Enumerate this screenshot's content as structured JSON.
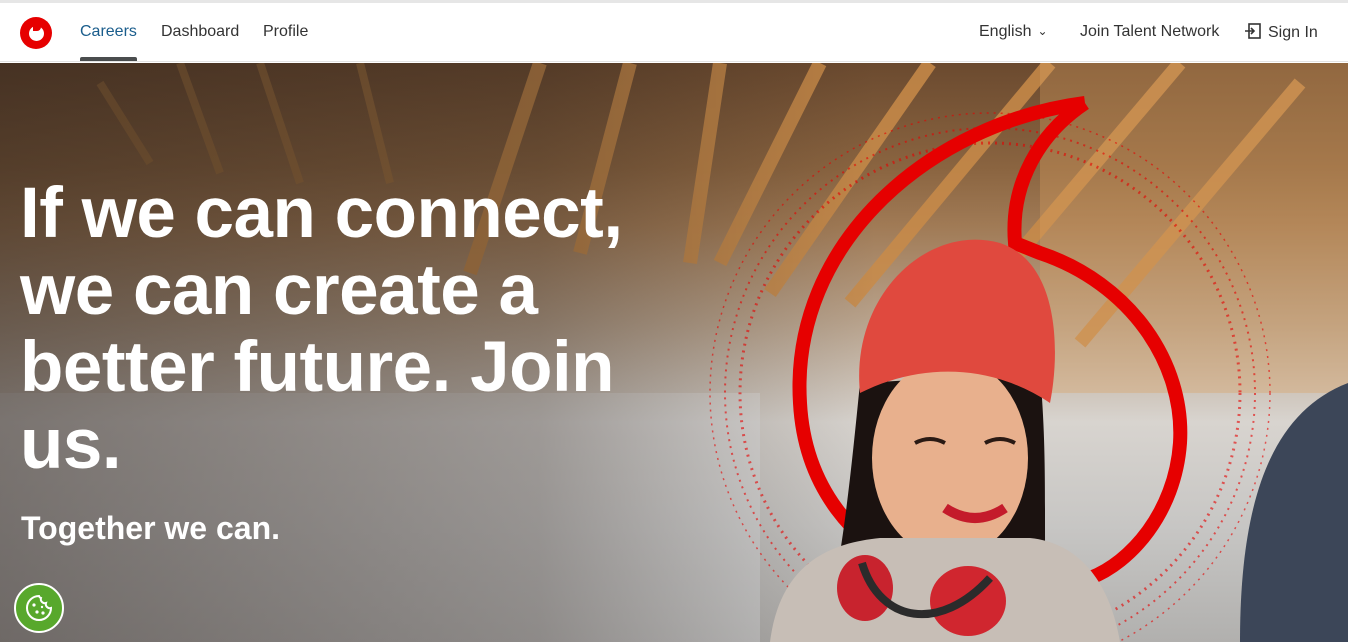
{
  "nav": {
    "logo_alt": "Vodafone",
    "links": [
      {
        "label": "Careers",
        "active": true
      },
      {
        "label": "Dashboard",
        "active": false
      },
      {
        "label": "Profile",
        "active": false
      }
    ],
    "language": "English",
    "talent_network": "Join Talent Network",
    "sign_in": "Sign In"
  },
  "hero": {
    "headline": "If we can connect, we can create a better future. Join us.",
    "subhead": "Together we can."
  },
  "colors": {
    "brand_red": "#e60000",
    "cookie_green": "#58a82c",
    "active_link": "#1a5d8c"
  },
  "icons": {
    "language_chevron": "chevron-down-icon",
    "sign_in": "sign-in-icon",
    "cookie": "cookie-icon"
  }
}
